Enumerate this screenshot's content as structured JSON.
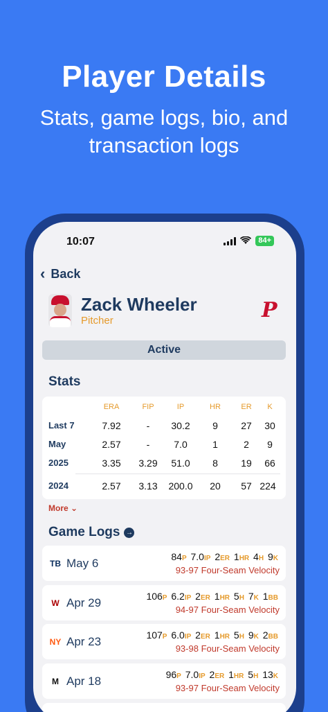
{
  "promo": {
    "title": "Player Details",
    "subtitle_line1": "Stats, game logs, bio, and",
    "subtitle_line2": "transaction logs"
  },
  "status_bar": {
    "time": "10:07",
    "battery": "84+"
  },
  "nav": {
    "back_label": "Back"
  },
  "player": {
    "name": "Zack Wheeler",
    "position": "Pitcher",
    "team_logo": "P",
    "status": "Active"
  },
  "stats": {
    "title": "Stats",
    "columns": [
      "ERA",
      "FIP",
      "IP",
      "HR",
      "ER",
      "K"
    ],
    "rows": [
      {
        "label": "Last 7",
        "values": [
          "7.92",
          "-",
          "30.2",
          "9",
          "27",
          "30"
        ]
      },
      {
        "label": "May",
        "values": [
          "2.57",
          "-",
          "7.0",
          "1",
          "2",
          "9"
        ]
      },
      {
        "label": "2025",
        "values": [
          "3.35",
          "3.29",
          "51.0",
          "8",
          "19",
          "66"
        ]
      },
      {
        "label": "2024",
        "values": [
          "2.57",
          "3.13",
          "200.0",
          "20",
          "57",
          "224"
        ]
      }
    ],
    "more_label": "More"
  },
  "game_logs": {
    "title": "Game Logs",
    "entries": [
      {
        "team_logo": "TB",
        "logo_color": "#092c5c",
        "date": "May 6",
        "p": "84",
        "ip": "7.0",
        "er": "2",
        "hr": "1",
        "h": "4",
        "k": "9",
        "bb": "",
        "velocity": "93-97 Four-Seam Velocity"
      },
      {
        "team_logo": "W",
        "logo_color": "#ab0003",
        "date": "Apr 29",
        "p": "106",
        "ip": "6.2",
        "er": "2",
        "hr": "1",
        "h": "5",
        "k": "7",
        "bb": "1",
        "velocity": "94-97 Four-Seam Velocity"
      },
      {
        "team_logo": "NY",
        "logo_color": "#ff5910",
        "date": "Apr 23",
        "p": "107",
        "ip": "6.0",
        "er": "2",
        "hr": "1",
        "h": "5",
        "k": "9",
        "bb": "2",
        "velocity": "93-98 Four-Seam Velocity"
      },
      {
        "team_logo": "M",
        "logo_color": "#111111",
        "date": "Apr 18",
        "p": "96",
        "ip": "7.0",
        "er": "2",
        "hr": "1",
        "h": "5",
        "k": "13",
        "bb": "",
        "velocity": "93-97 Four-Seam Velocity"
      }
    ]
  },
  "colors": {
    "background": "#3a7af3",
    "accent": "#e59a2b",
    "navy": "#1e3a5f",
    "red": "#c0392b"
  }
}
